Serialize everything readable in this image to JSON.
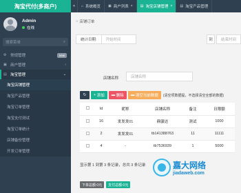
{
  "sidebar": {
    "brand": "淘宝代付(多商户)",
    "user": {
      "name": "Admin",
      "status": "在线"
    },
    "search_placeholder": "搜索菜单",
    "menu": [
      {
        "label": "常规管理",
        "icon": "gear-icon",
        "badge": "new"
      },
      {
        "label": "商户管理",
        "icon": "users-icon",
        "chevron": "‹"
      },
      {
        "label": "淘宝管理",
        "icon": "folder-icon",
        "chevron": "⌄",
        "active": true
      }
    ],
    "submenu": [
      {
        "label": "淘宝店铺管理",
        "current": true
      },
      {
        "label": "淘宝产品管理"
      },
      {
        "label": "淘宝订单管理"
      },
      {
        "label": "淘宝支付测试"
      },
      {
        "label": "淘宝订单统计"
      },
      {
        "label": "店铺备份管理"
      },
      {
        "label": "开发订单管理"
      }
    ]
  },
  "tabs": [
    {
      "label": "系统概览",
      "icon": "home-icon"
    },
    {
      "label": "商户列表",
      "icon": "users-icon"
    },
    {
      "label": "淘宝店铺管理",
      "icon": "shop-icon",
      "active": true
    },
    {
      "label": "淘宝产品管理",
      "icon": "shop-icon"
    }
  ],
  "breadcrumb": "店铺订单",
  "filters": {
    "date_label": "统计日期:",
    "date_start_placeholder": "开始时间",
    "to_label": "到",
    "date_end_placeholder": "结束时间",
    "shop_label": "店铺名称",
    "shop_placeholder": "店铺名称"
  },
  "toolbar": {
    "add": "添加",
    "delete": "删除",
    "clear": "清空当前数据",
    "tip": "(清空项数据提，不选择清空全部的数据)"
  },
  "table": {
    "headers": [
      "Id",
      "昵称",
      "店铺名称",
      "备注",
      "日限额"
    ],
    "rows": [
      [
        "16",
        "发发发01",
        "鼎骏达",
        "测试",
        "1000"
      ],
      [
        "2",
        "发发发01",
        "tb141388763",
        "11",
        "11111"
      ],
      [
        "4",
        "-",
        "tb7536939",
        "1",
        "5000"
      ]
    ]
  },
  "pager": "显示第 1 到第 3 条记录，总共 3 条记录",
  "summary": {
    "left": "下单总额:0元",
    "right": "支付总额:0元"
  },
  "watermark": {
    "cn": "嘉大网络",
    "en": "jiadaweb.com"
  },
  "colors": {
    "sidebar": "#2f4050",
    "accent": "#1ab394",
    "danger": "#ed5565",
    "warning": "#f8ac59"
  }
}
